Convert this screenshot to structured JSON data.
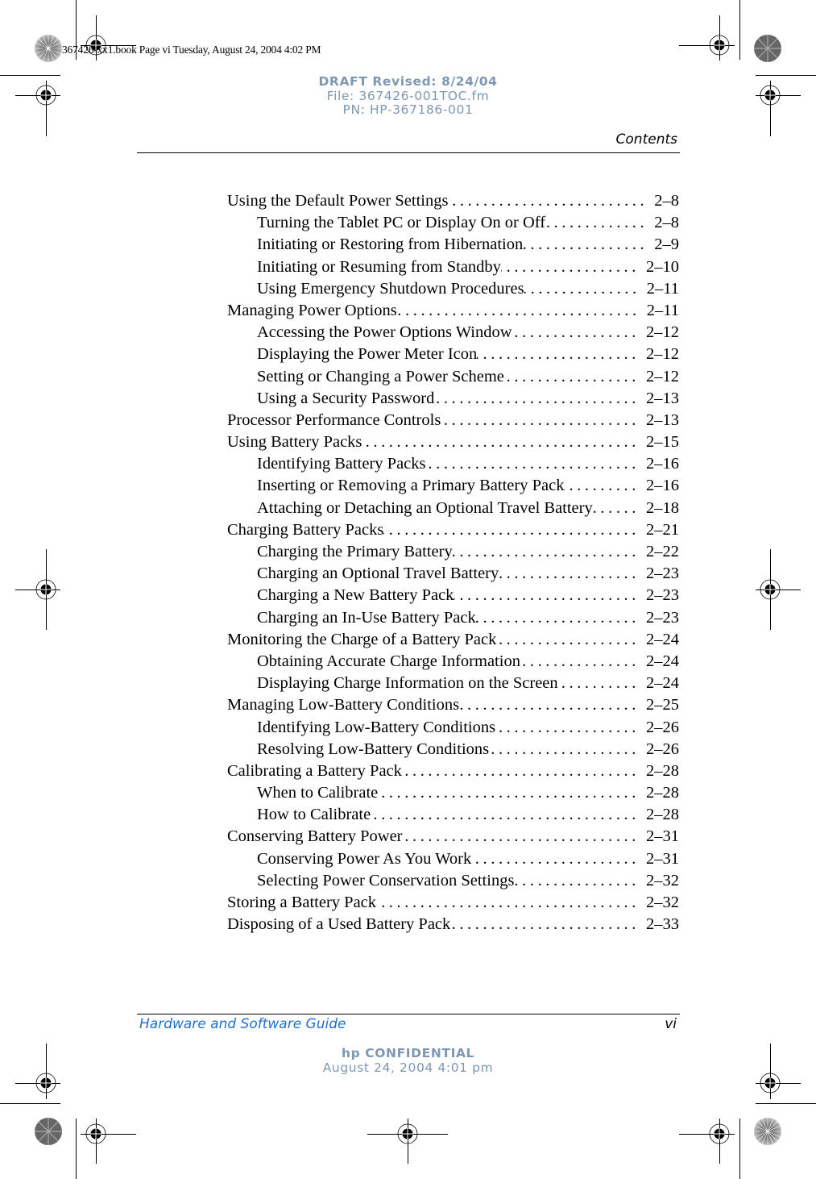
{
  "print_slug": "367426-xx1.book  Page vi  Tuesday, August 24, 2004  4:02 PM",
  "draft_stamp": {
    "line1": "DRAFT Revised: 8/24/04",
    "line2": "File: 367426-001TOC.fm",
    "line3": "PN: HP-367186-001",
    "color": "#7e97b3"
  },
  "running_head": "Contents",
  "toc": [
    {
      "level": 1,
      "title": "Using the Default Power Settings",
      "page": "2–8"
    },
    {
      "level": 2,
      "title": "Turning the Tablet PC or Display On or Off",
      "page": "2–8"
    },
    {
      "level": 2,
      "title": "Initiating or Restoring from Hibernation",
      "page": "2–9"
    },
    {
      "level": 2,
      "title": "Initiating or Resuming from Standby",
      "page": "2–10"
    },
    {
      "level": 2,
      "title": "Using Emergency Shutdown Procedures",
      "page": "2–11"
    },
    {
      "level": 1,
      "title": "Managing Power Options",
      "page": "2–11"
    },
    {
      "level": 2,
      "title": "Accessing the Power Options Window",
      "page": "2–12"
    },
    {
      "level": 2,
      "title": "Displaying the Power Meter Icon",
      "page": "2–12"
    },
    {
      "level": 2,
      "title": "Setting or Changing a Power Scheme",
      "page": "2–12"
    },
    {
      "level": 2,
      "title": "Using a Security Password",
      "page": "2–13"
    },
    {
      "level": 1,
      "title": "Processor Performance Controls",
      "page": "2–13"
    },
    {
      "level": 1,
      "title": "Using Battery Packs",
      "page": "2–15"
    },
    {
      "level": 2,
      "title": "Identifying Battery Packs",
      "page": "2–16"
    },
    {
      "level": 2,
      "title": "Inserting or Removing a Primary Battery Pack",
      "page": "2–16"
    },
    {
      "level": 2,
      "title": "Attaching or Detaching an Optional Travel Battery",
      "page": "2–18"
    },
    {
      "level": 1,
      "title": "Charging Battery Packs",
      "page": "2–21"
    },
    {
      "level": 2,
      "title": "Charging the Primary Battery",
      "page": "2–22"
    },
    {
      "level": 2,
      "title": "Charging an Optional Travel Battery",
      "page": "2–23"
    },
    {
      "level": 2,
      "title": "Charging a New Battery Pack",
      "page": "2–23"
    },
    {
      "level": 2,
      "title": "Charging an In-Use Battery Pack",
      "page": "2–23"
    },
    {
      "level": 1,
      "title": "Monitoring the Charge of a Battery Pack",
      "page": "2–24"
    },
    {
      "level": 2,
      "title": "Obtaining Accurate Charge Information",
      "page": "2–24"
    },
    {
      "level": 2,
      "title": "Displaying Charge Information on the Screen",
      "page": "2–24"
    },
    {
      "level": 1,
      "title": "Managing Low-Battery Conditions",
      "page": "2–25"
    },
    {
      "level": 2,
      "title": "Identifying Low-Battery Conditions",
      "page": "2–26"
    },
    {
      "level": 2,
      "title": "Resolving Low-Battery Conditions",
      "page": "2–26"
    },
    {
      "level": 1,
      "title": "Calibrating a Battery Pack",
      "page": "2–28"
    },
    {
      "level": 2,
      "title": "When to Calibrate",
      "page": "2–28"
    },
    {
      "level": 2,
      "title": "How to Calibrate",
      "page": "2–28"
    },
    {
      "level": 1,
      "title": "Conserving Battery Power",
      "page": "2–31"
    },
    {
      "level": 2,
      "title": "Conserving Power As You Work",
      "page": "2–31"
    },
    {
      "level": 2,
      "title": "Selecting Power Conservation Settings",
      "page": "2–32"
    },
    {
      "level": 1,
      "title": "Storing a Battery Pack",
      "page": "2–32"
    },
    {
      "level": 1,
      "title": "Disposing of a Used Battery Pack",
      "page": "2–33"
    }
  ],
  "footer": {
    "title": "Hardware and Software Guide",
    "page_number": "vi",
    "title_color": "#1e6fd0"
  },
  "confidential_stamp": {
    "line1": "hp CONFIDENTIAL",
    "line2": "August 24, 2004 4:01 pm",
    "color": "#7e97b3"
  }
}
